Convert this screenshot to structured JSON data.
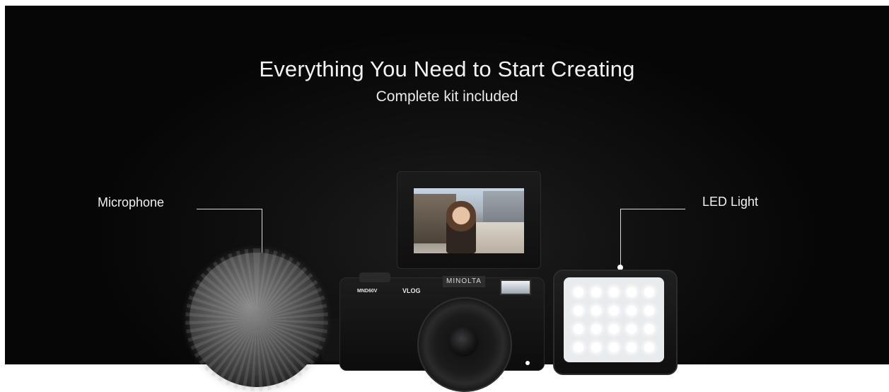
{
  "hero": {
    "headline": "Everything You Need to Start Creating",
    "subheadline": "Complete kit included"
  },
  "callouts": {
    "microphone": "Microphone",
    "led_light": "LED Light"
  },
  "camera": {
    "brand": "MINOLTA",
    "model": "MND60V",
    "badge": "VLOG"
  },
  "colors": {
    "background": "#0d0d0e",
    "text": "#f3f3f3",
    "accent_line": "#d8d8d8"
  }
}
